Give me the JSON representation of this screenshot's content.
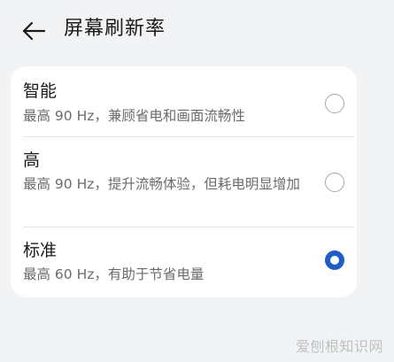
{
  "header": {
    "title": "屏幕刷新率",
    "back_icon": "arrow-left-icon"
  },
  "options": [
    {
      "title": "智能",
      "description": "最高 90 Hz，兼顾省电和画面流畅性",
      "selected": false
    },
    {
      "title": "高",
      "description": "最高 90 Hz，提升流畅体验，但耗电明显增加",
      "selected": false
    },
    {
      "title": "标准",
      "description": "最高 60 Hz，有助于节省电量",
      "selected": true
    }
  ],
  "watermark": "爱刨根知识网",
  "colors": {
    "accent": "#1f5cc6",
    "background": "#f1f3f5",
    "card": "#ffffff"
  }
}
